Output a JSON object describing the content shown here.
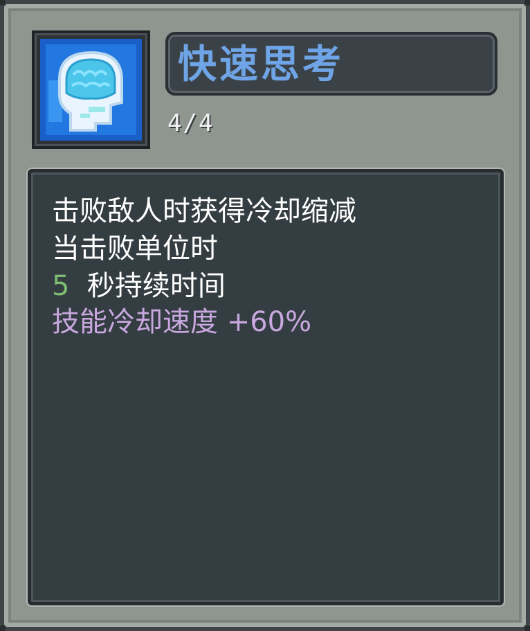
{
  "skill": {
    "name": "快速思考",
    "level": "4/4",
    "icon": "brain-head-icon",
    "description": {
      "line1": "击败敌人时获得冷却缩减",
      "line2": "当击败单位时",
      "line3_value": "5",
      "line3_text": "秒持续时间",
      "line4_text": "技能冷却速度",
      "line4_value": "+60%"
    }
  },
  "colors": {
    "title": "#6fa4e6",
    "duration_value": "#7ebd72",
    "bonus": "#c8a8df",
    "panel": "#343d41",
    "frame": "#8f9690"
  }
}
